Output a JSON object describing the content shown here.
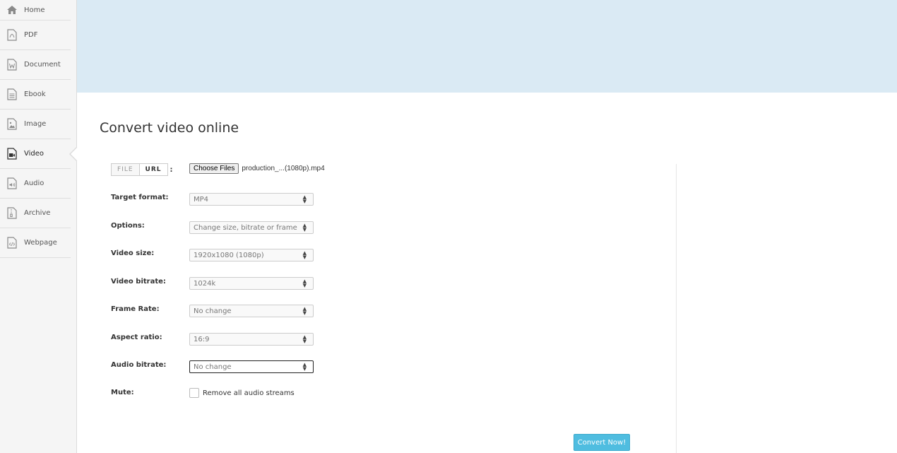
{
  "sidebar": {
    "items": [
      {
        "label": "Home",
        "icon": "home-icon"
      },
      {
        "label": "PDF",
        "icon": "pdf-icon"
      },
      {
        "label": "Document",
        "icon": "document-icon"
      },
      {
        "label": "Ebook",
        "icon": "ebook-icon"
      },
      {
        "label": "Image",
        "icon": "image-icon"
      },
      {
        "label": "Video",
        "icon": "video-icon",
        "active": true
      },
      {
        "label": "Audio",
        "icon": "audio-icon"
      },
      {
        "label": "Archive",
        "icon": "archive-icon"
      },
      {
        "label": "Webpage",
        "icon": "webpage-icon"
      }
    ]
  },
  "main": {
    "title": "Convert video online",
    "source_tabs": {
      "file": "FILE",
      "url": "URL",
      "colon": ":"
    },
    "file_input": {
      "button_label": "Choose Files",
      "file_name": "production_...(1080p).mp4"
    },
    "fields": {
      "target_format": {
        "label": "Target format:",
        "value": "MP4"
      },
      "options": {
        "label": "Options:",
        "value": "Change size, bitrate or frame rate"
      },
      "video_size": {
        "label": "Video size:",
        "value": "1920x1080 (1080p)"
      },
      "video_bitrate": {
        "label": "Video bitrate:",
        "value": "1024k"
      },
      "frame_rate": {
        "label": "Frame Rate:",
        "value": "No change"
      },
      "aspect_ratio": {
        "label": "Aspect ratio:",
        "value": "16:9"
      },
      "audio_bitrate": {
        "label": "Audio bitrate:",
        "value": "No change"
      }
    },
    "mute": {
      "label": "Mute:",
      "checkbox_label": "Remove all audio streams",
      "checked": false
    },
    "convert_button": "Convert Now!"
  },
  "colors": {
    "banner": "#daeaf4",
    "accent": "#4fbde0",
    "sidebar_bg": "#f5f5f5"
  }
}
